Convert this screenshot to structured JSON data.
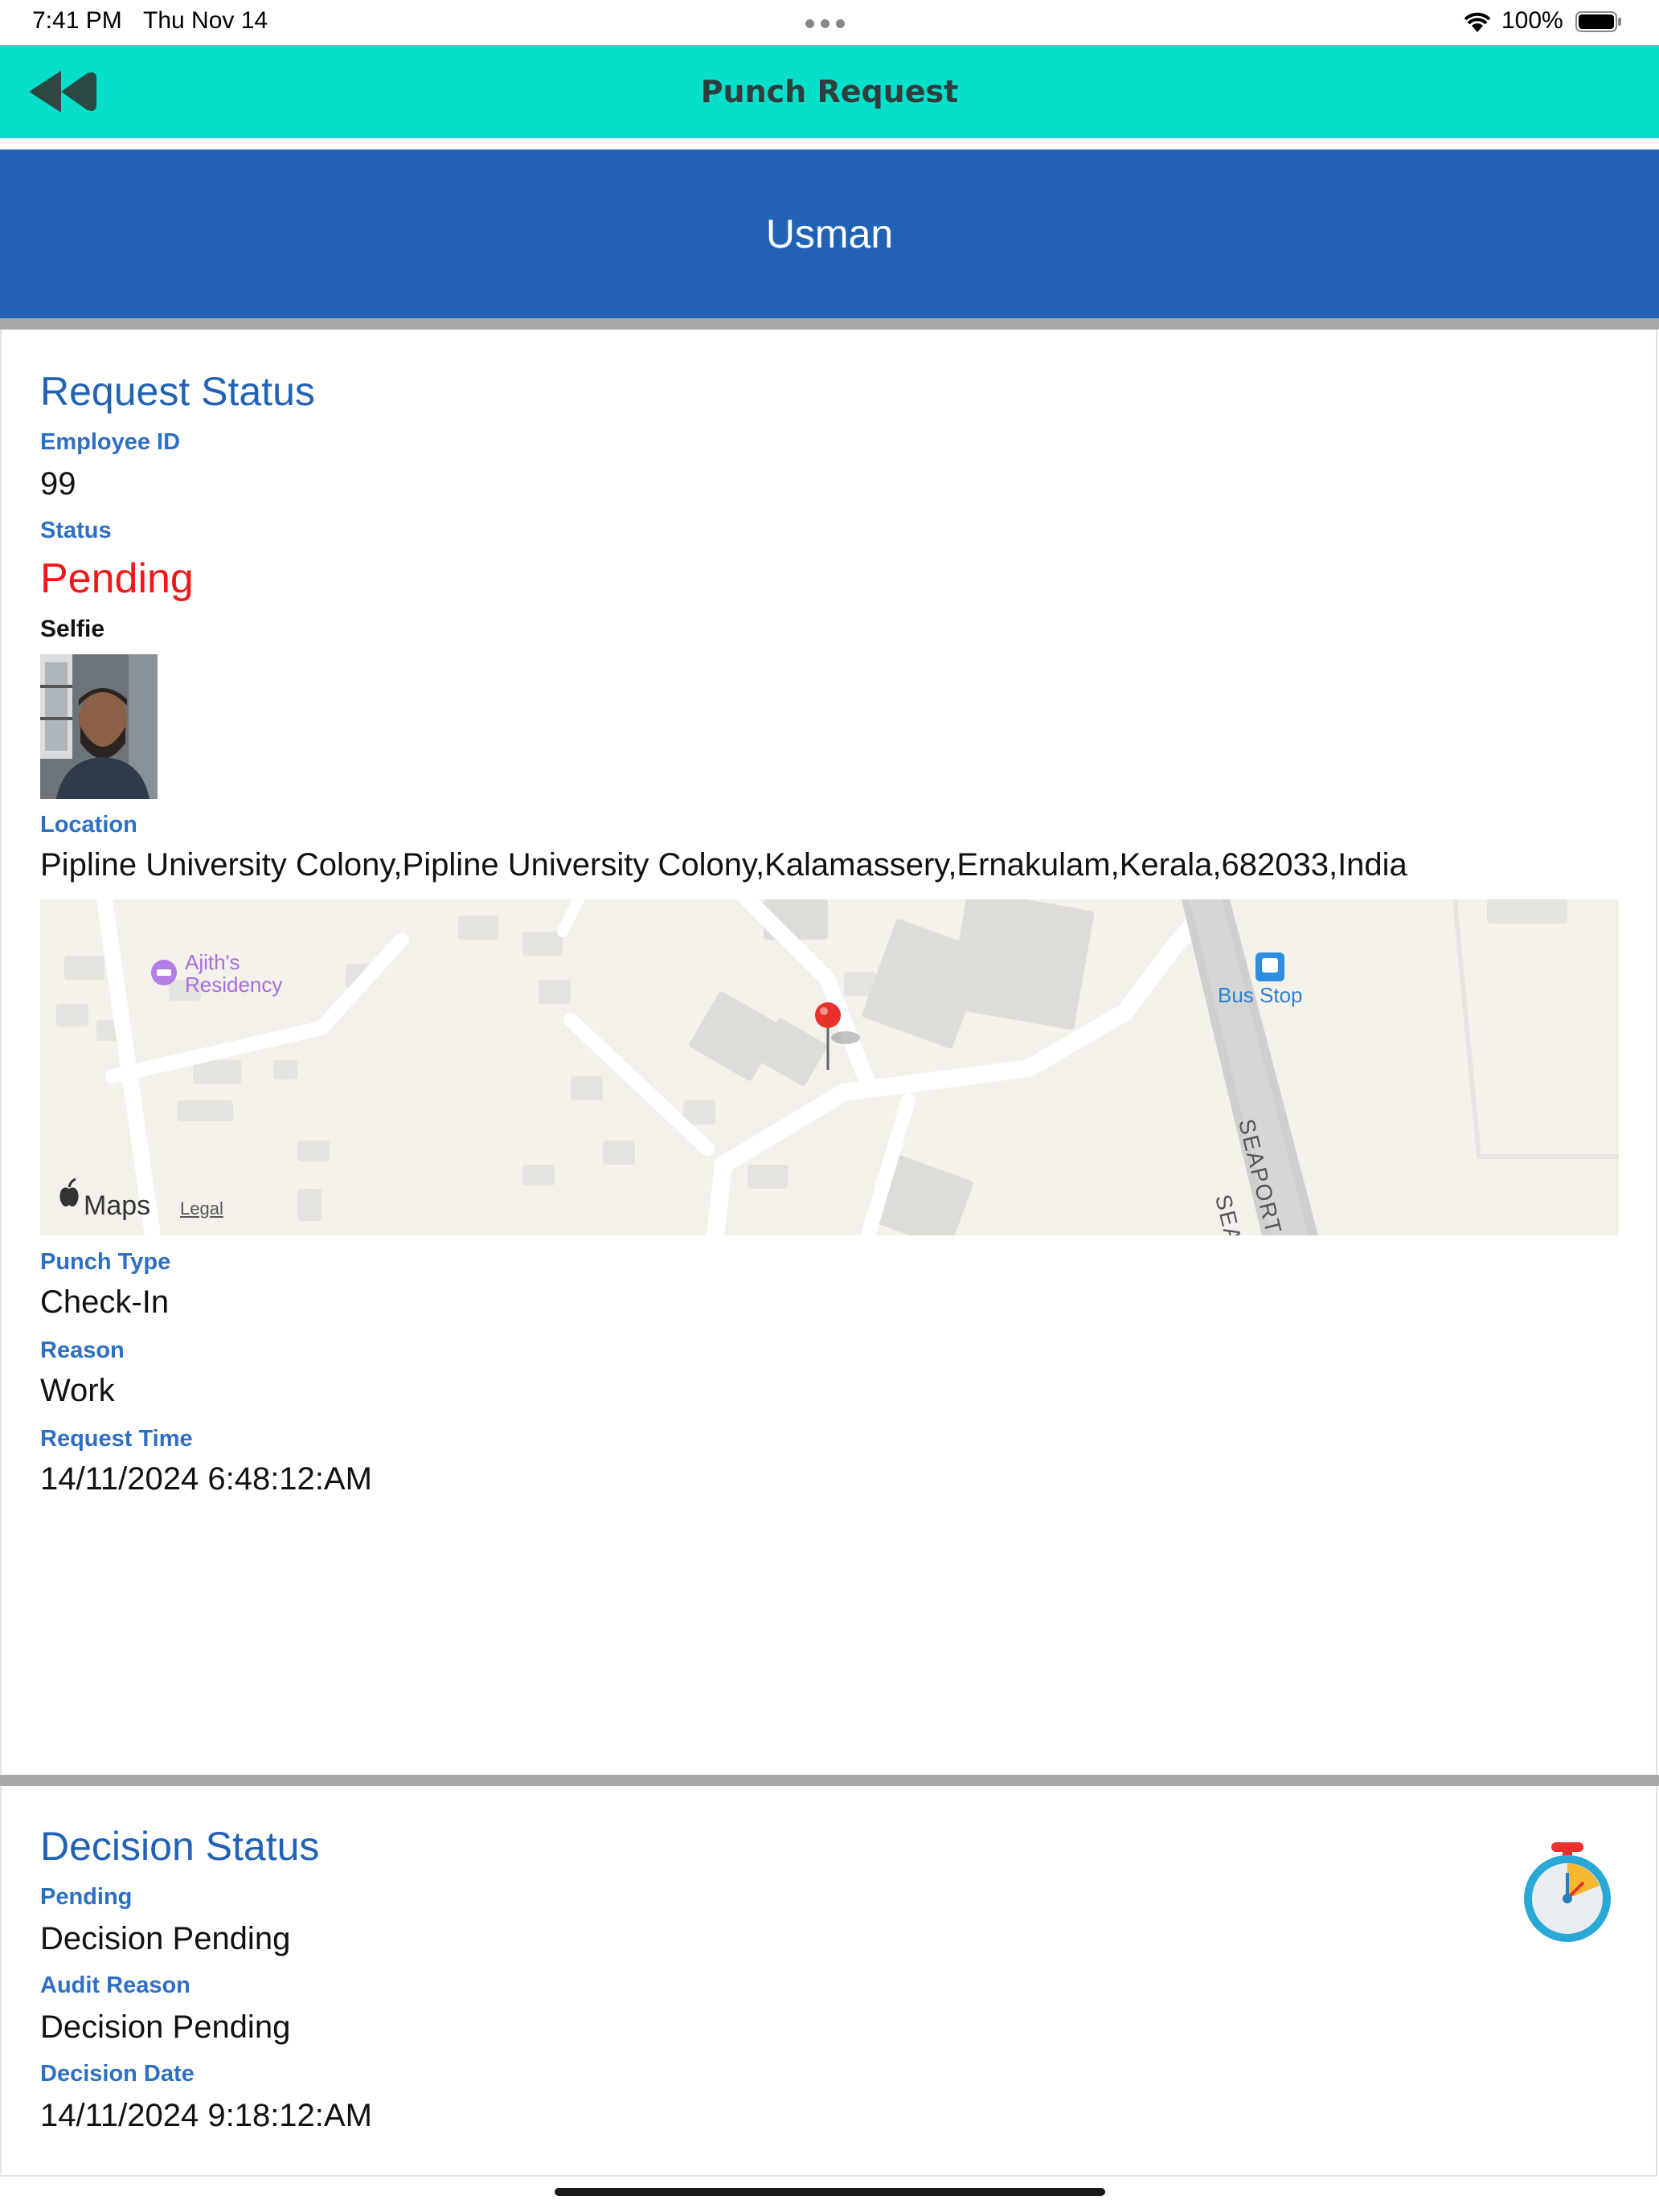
{
  "status_bar": {
    "time": "7:41 PM",
    "date": "Thu Nov 14",
    "battery": "100%"
  },
  "navbar": {
    "title": "Punch Request",
    "back_icon": "rewind-icon",
    "background": "#07dfcb"
  },
  "user": {
    "name": "Usman",
    "banner_color": "#2162b5"
  },
  "request_status": {
    "title": "Request Status",
    "employee_id_label": "Employee ID",
    "employee_id": "99",
    "status_label": "Status",
    "status": "Pending",
    "status_color": "#f21717",
    "selfie_label": "Selfie",
    "location_label": "Location",
    "location": "Pipline University Colony,Pipline University Colony,Kalamassery,Ernakulam,Kerala,682033,India",
    "map": {
      "poi_residency": "Ajith's\nResidency",
      "poi_residency_line1": "Ajith's",
      "poi_residency_line2": "Residency",
      "poi_bus": "Bus Stop",
      "road_label": "SEAPORT AIR",
      "road_label2": "SEA",
      "attribution": "Maps",
      "legal": "Legal"
    },
    "punch_type_label": "Punch Type",
    "punch_type": "Check-In",
    "reason_label": "Reason",
    "reason": "Work",
    "request_time_label": "Request Time",
    "request_time": "14/11/2024 6:48:12:AM"
  },
  "decision_status": {
    "title": "Decision Status",
    "pending_label": "Pending",
    "pending_value": "Decision Pending",
    "audit_reason_label": "Audit Reason",
    "audit_reason": "Decision Pending",
    "decision_date_label": "Decision Date",
    "decision_date": "14/11/2024 9:18:12:AM",
    "icon": "stopwatch-icon"
  }
}
